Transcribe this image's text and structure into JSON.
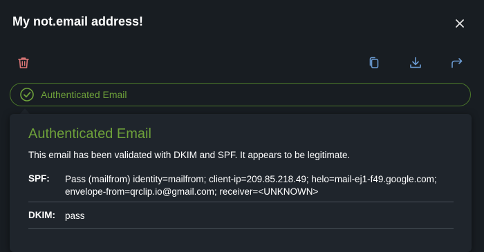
{
  "header": {
    "title": "My not.email address!"
  },
  "toolbar": {
    "delete_icon": "trash-icon",
    "copy_icon": "copy-icon",
    "download_icon": "download-icon",
    "forward_icon": "forward-icon"
  },
  "auth_status": {
    "label": "Authenticated Email",
    "color": "#6ea13a"
  },
  "popover": {
    "title": "Authenticated Email",
    "description": "This email has been validated with DKIM and SPF. It appears to be legitimate.",
    "rows": [
      {
        "key": "SPF:",
        "value": "Pass (mailfrom) identity=mailfrom; client-ip=209.85.218.49; helo=mail-ej1-f49.google.com; envelope-from=qrclip.io@gmail.com; receiver=<UNKNOWN>"
      },
      {
        "key": "DKIM:",
        "value": "pass"
      }
    ]
  },
  "colors": {
    "background": "#181d22",
    "popover_bg": "#1f252c",
    "accent_green": "#6ea13a",
    "delete_red": "#e07878",
    "icon_blue": "#6b9bd2"
  }
}
